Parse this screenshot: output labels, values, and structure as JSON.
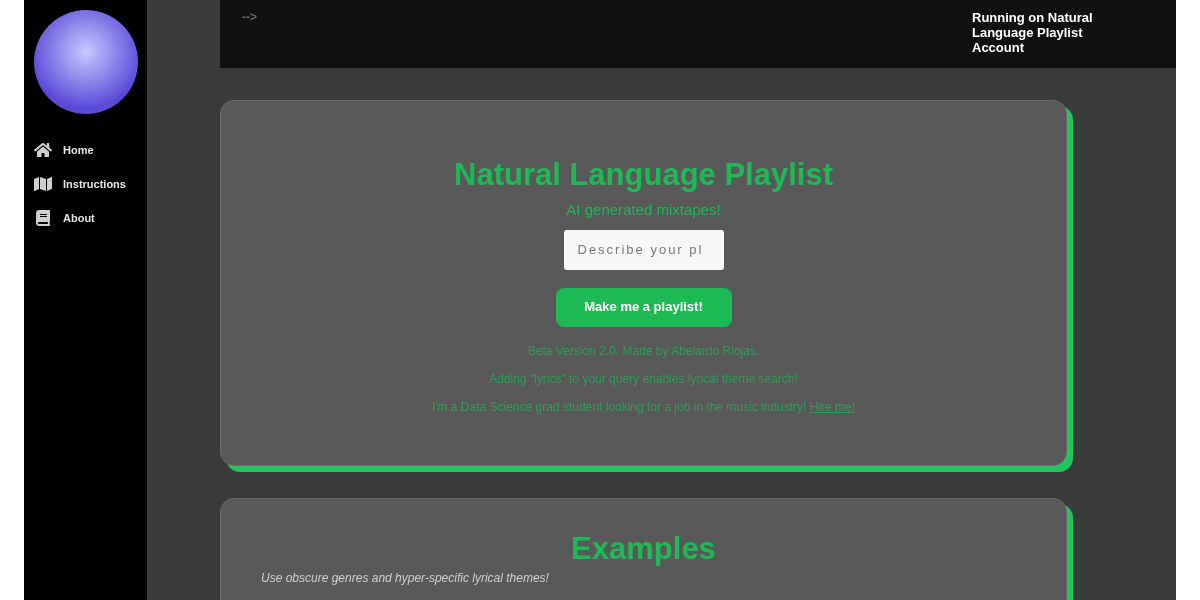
{
  "sidebar": {
    "items": [
      {
        "label": "Home",
        "kind": "home"
      },
      {
        "label": "Instructions",
        "kind": "map"
      },
      {
        "label": "About",
        "kind": "book"
      }
    ]
  },
  "header": {
    "arrow": "-->",
    "account": "Running on Natural Language Playlist Account"
  },
  "hero": {
    "title": "Natural Language Playlist",
    "subtitle": "AI generated mixtapes!",
    "input": {
      "placeholder": "Describe your pl"
    },
    "button": "Make me a playlist!",
    "notes": [
      "Beta Version 2.0. Made by Abelardo Riojas.",
      "Adding \"lyrics\" to your query enables lyrical theme search!"
    ],
    "hire": {
      "text": "I'm a Data Science grad student looking for a job in the music industry!",
      "link": "Hire me!"
    }
  },
  "examples": {
    "title": "Examples",
    "subtitle": "Use obscure genres and hyper-specific lyrical themes!"
  }
}
